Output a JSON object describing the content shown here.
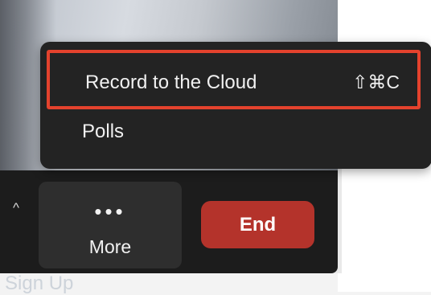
{
  "menu": {
    "items": [
      {
        "label": "Record to the Cloud",
        "shortcut": "⇧⌘C"
      },
      {
        "label": "Polls"
      }
    ]
  },
  "toolbar": {
    "caret": "^",
    "more_dots": "•••",
    "more_label": "More",
    "end_label": "End"
  },
  "footer": {
    "sign_up": "Sign Up"
  },
  "colors": {
    "highlight_border": "#e4422d",
    "end_button": "#b4332b",
    "menu_bg": "#232323",
    "toolbar_bg": "#1c1c1c"
  }
}
